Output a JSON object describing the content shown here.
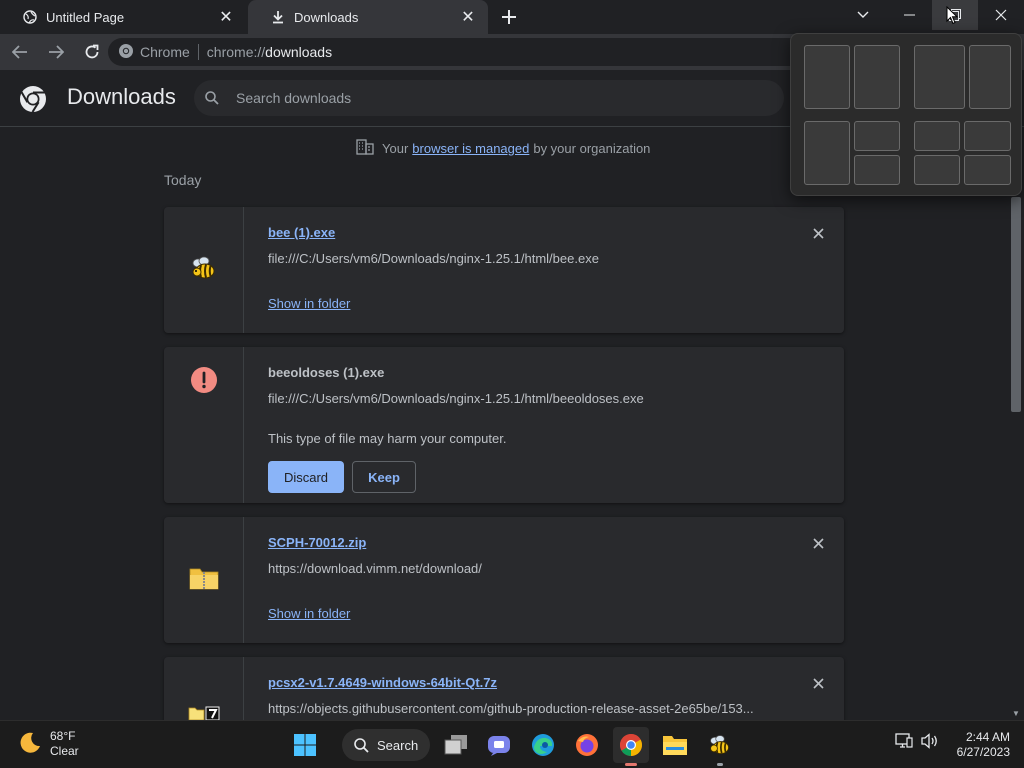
{
  "tabs": [
    {
      "title": "Untitled Page",
      "icon": "globe-icon"
    },
    {
      "title": "Downloads",
      "icon": "download-icon"
    }
  ],
  "toolbar": {
    "omnibox_chip": "Chrome",
    "url_scheme": "chrome://",
    "url_host": "downloads"
  },
  "header": {
    "title": "Downloads",
    "search_placeholder": "Search downloads"
  },
  "managed_notice": {
    "prefix": "Your",
    "link": "browser is managed",
    "suffix": "by your organization"
  },
  "section_label": "Today",
  "downloads": [
    {
      "filename": "bee (1).exe",
      "url": "file:///C:/Users/vm6/Downloads/nginx-1.25.1/html/bee.exe",
      "link": "Show in folder",
      "icon": "bee-icon"
    },
    {
      "filename": "beeoldoses (1).exe",
      "url": "file:///C:/Users/vm6/Downloads/nginx-1.25.1/html/beeoldoses.exe",
      "warning": "This type of file may harm your computer.",
      "discard_label": "Discard",
      "keep_label": "Keep",
      "icon": "warning-icon"
    },
    {
      "filename": "SCPH-70012.zip",
      "url": "https://download.vimm.net/download/",
      "link": "Show in folder",
      "icon": "zip-folder-icon"
    },
    {
      "filename": "pcsx2-v1.7.4649-windows-64bit-Qt.7z",
      "url": "https://objects.githubusercontent.com/github-production-release-asset-2e65be/153...",
      "icon": "7z-archive-icon"
    }
  ],
  "taskbar": {
    "weather_temp": "68°F",
    "weather_desc": "Clear",
    "search_label": "Search",
    "time": "2:44 AM",
    "date": "6/27/2023"
  },
  "colors": {
    "accent": "#8ab4f8",
    "background": "#202124",
    "card": "#292a2d",
    "danger": "#f28b82"
  }
}
